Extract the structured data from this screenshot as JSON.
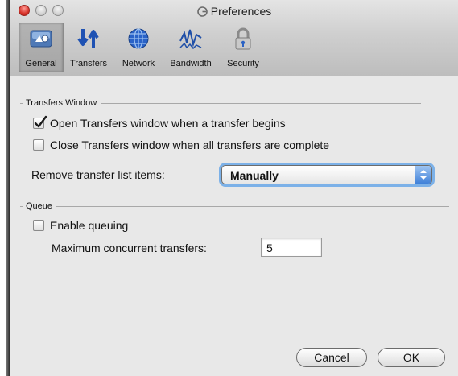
{
  "window": {
    "title": "Preferences"
  },
  "toolbar": {
    "items": [
      {
        "label": "General",
        "icon": "general-icon",
        "selected": true
      },
      {
        "label": "Transfers",
        "icon": "transfers-icon",
        "selected": false
      },
      {
        "label": "Network",
        "icon": "network-globe-icon",
        "selected": false
      },
      {
        "label": "Bandwidth",
        "icon": "bandwidth-icon",
        "selected": false
      },
      {
        "label": "Security",
        "icon": "padlock-icon",
        "selected": false
      }
    ]
  },
  "transfers_window": {
    "heading": "Transfers Window",
    "open_on_begin": {
      "label": "Open Transfers window when a transfer begins",
      "checked": true
    },
    "close_on_complete": {
      "label": "Close Transfers window when all transfers are complete",
      "checked": false
    },
    "remove_items": {
      "label": "Remove transfer list items:",
      "value": "Manually"
    }
  },
  "queue": {
    "heading": "Queue",
    "enable_queuing": {
      "label": "Enable queuing",
      "checked": false
    },
    "max_concurrent": {
      "label": "Maximum concurrent transfers:",
      "value": "5"
    }
  },
  "buttons": {
    "cancel": "Cancel",
    "ok": "OK"
  },
  "colors": {
    "focus_ring": "#7cb1e8",
    "popup_arrow": "#3f80d8",
    "close_light": "#d8342b"
  }
}
